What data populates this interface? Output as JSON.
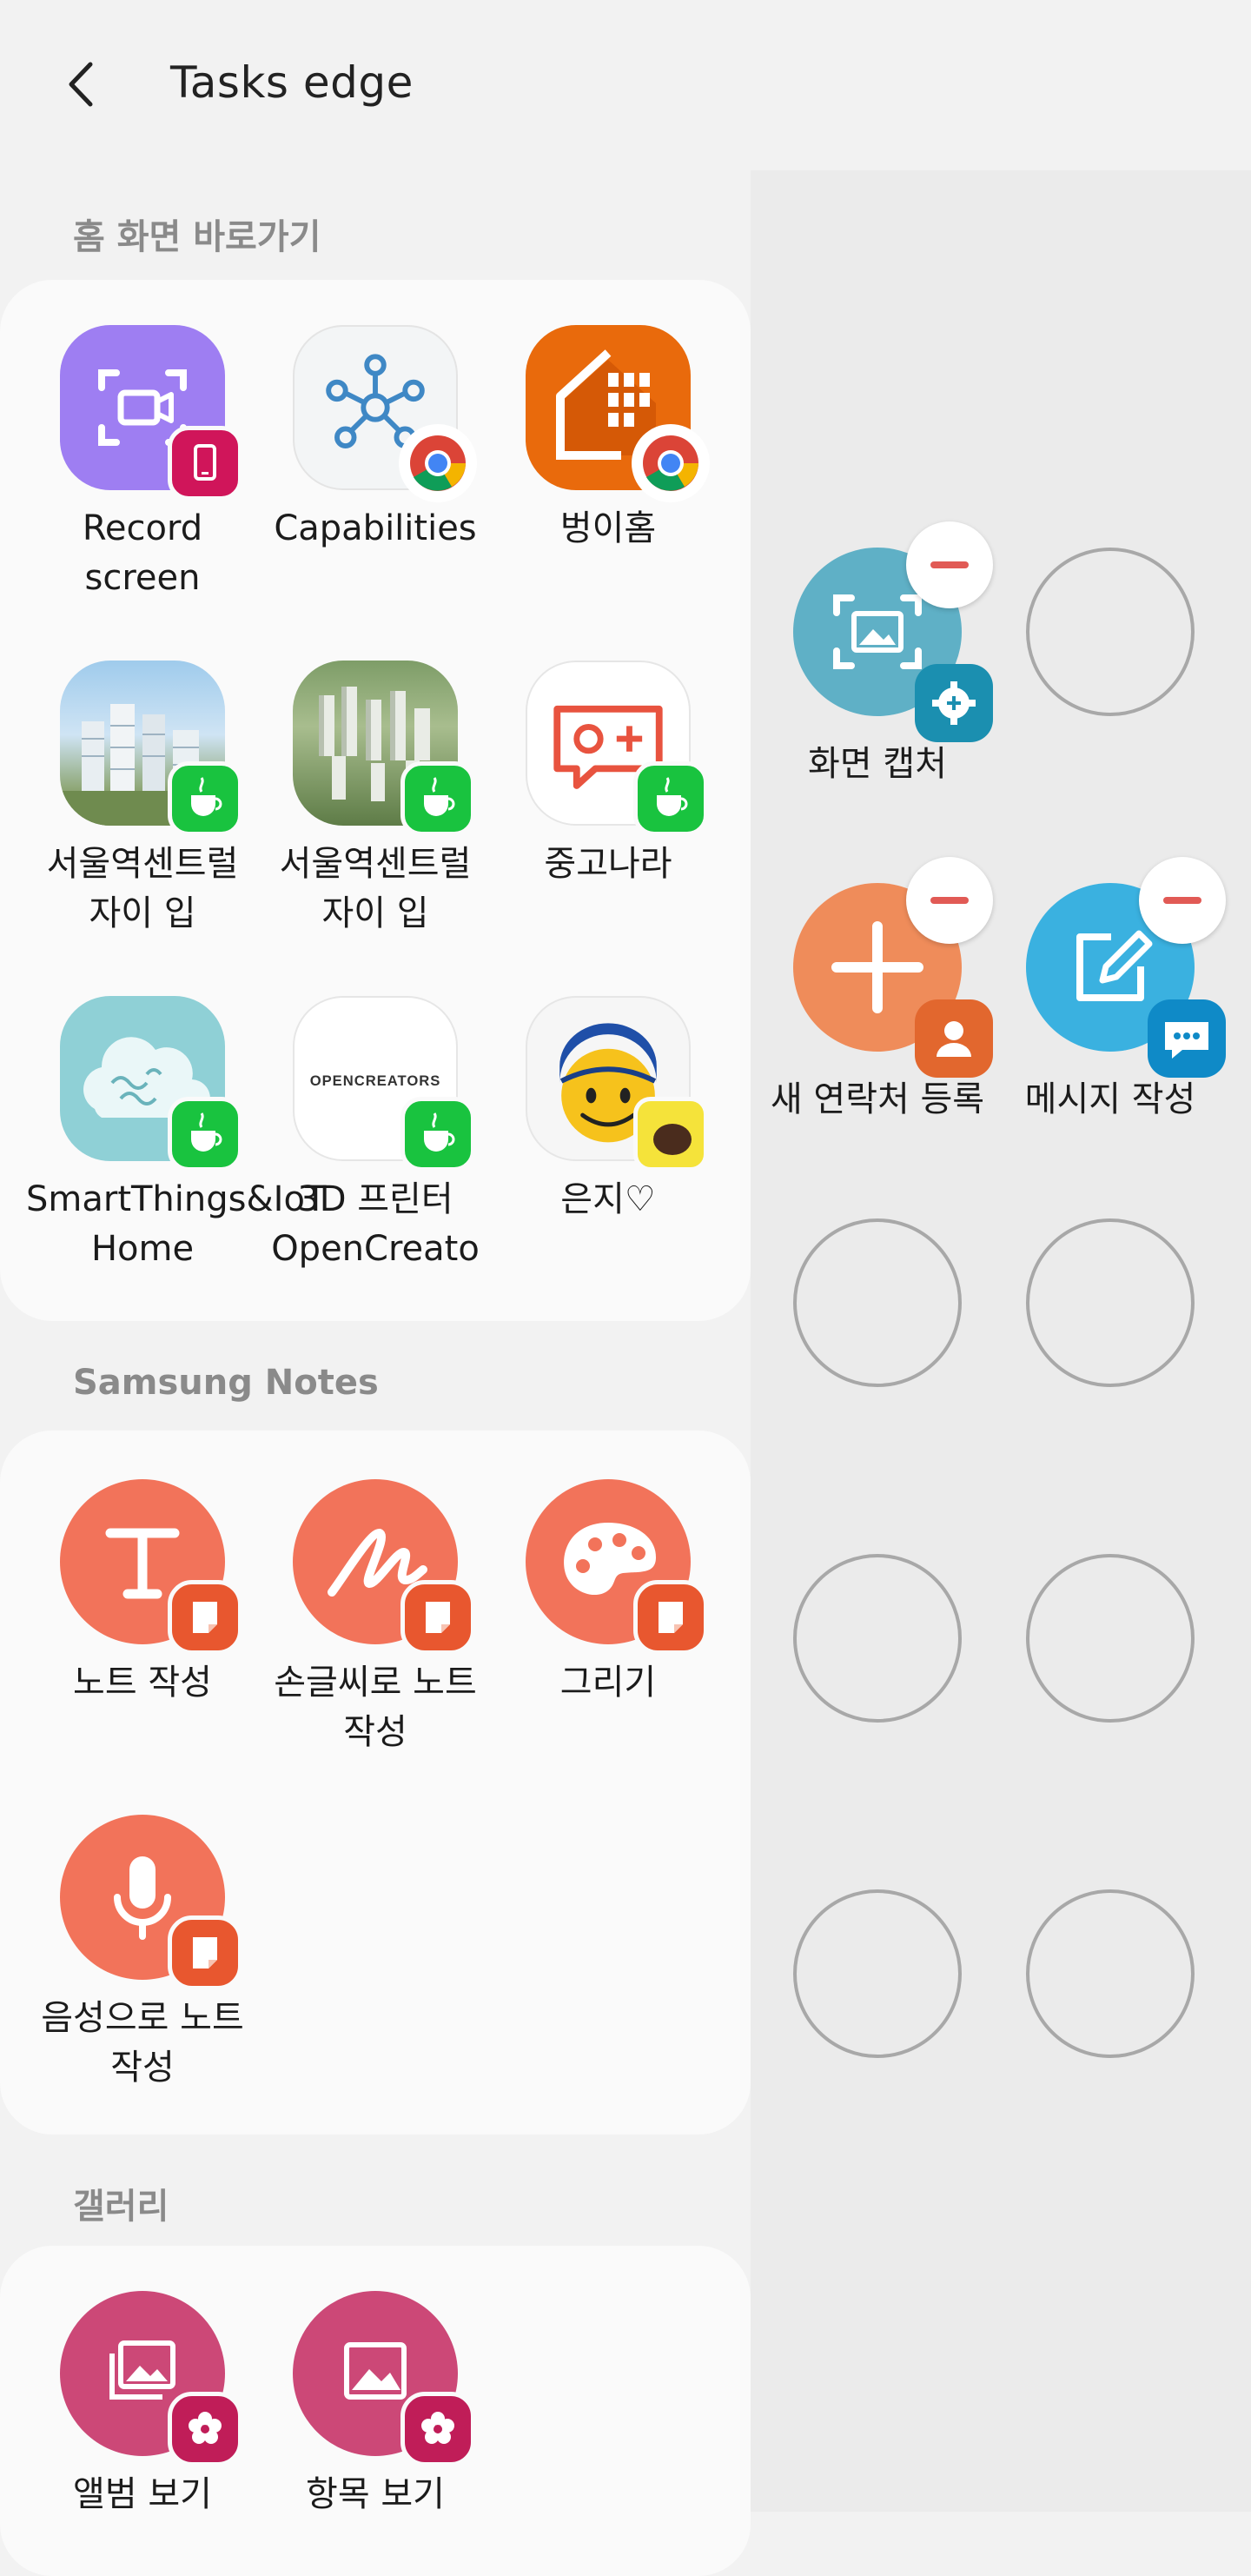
{
  "header": {
    "title": "Tasks edge"
  },
  "sections": [
    {
      "title": "홈 화면 바로가기",
      "apps": [
        {
          "label": "Record screen"
        },
        {
          "label": "Capabilities"
        },
        {
          "label": "벙이홈"
        },
        {
          "label": "서울역센트럴 자이 입"
        },
        {
          "label": "서울역센트럴 자이 입"
        },
        {
          "label": "중고나라"
        },
        {
          "label": "SmartThings&IoT Home"
        },
        {
          "label": "3D 프린터 OpenCreato"
        },
        {
          "label": "은지♡"
        }
      ]
    },
    {
      "title": "Samsung Notes",
      "apps": [
        {
          "label": "노트 작성"
        },
        {
          "label": "손글씨로 노트 작성"
        },
        {
          "label": "그리기"
        },
        {
          "label": "음성으로 노트 작성"
        }
      ]
    },
    {
      "title": "갤러리",
      "apps": [
        {
          "label": "앨범 보기"
        },
        {
          "label": "항목 보기"
        }
      ]
    }
  ],
  "edge_panel": {
    "items": [
      {
        "label": "화면 캡처",
        "icon": "screen-capture-icon"
      },
      {
        "label": "새 연락처 등록",
        "icon": "add-contact-icon"
      },
      {
        "label": "메시지 작성",
        "icon": "compose-message-icon"
      }
    ]
  },
  "colors": {
    "notes_orange": "#f2735a",
    "gallery_pink": "#cc4877",
    "capture_blue": "#5fb0c6",
    "contact_orange": "#ef8c5a",
    "message_blue": "#3ab1e0",
    "remove_red": "#e15a55"
  }
}
